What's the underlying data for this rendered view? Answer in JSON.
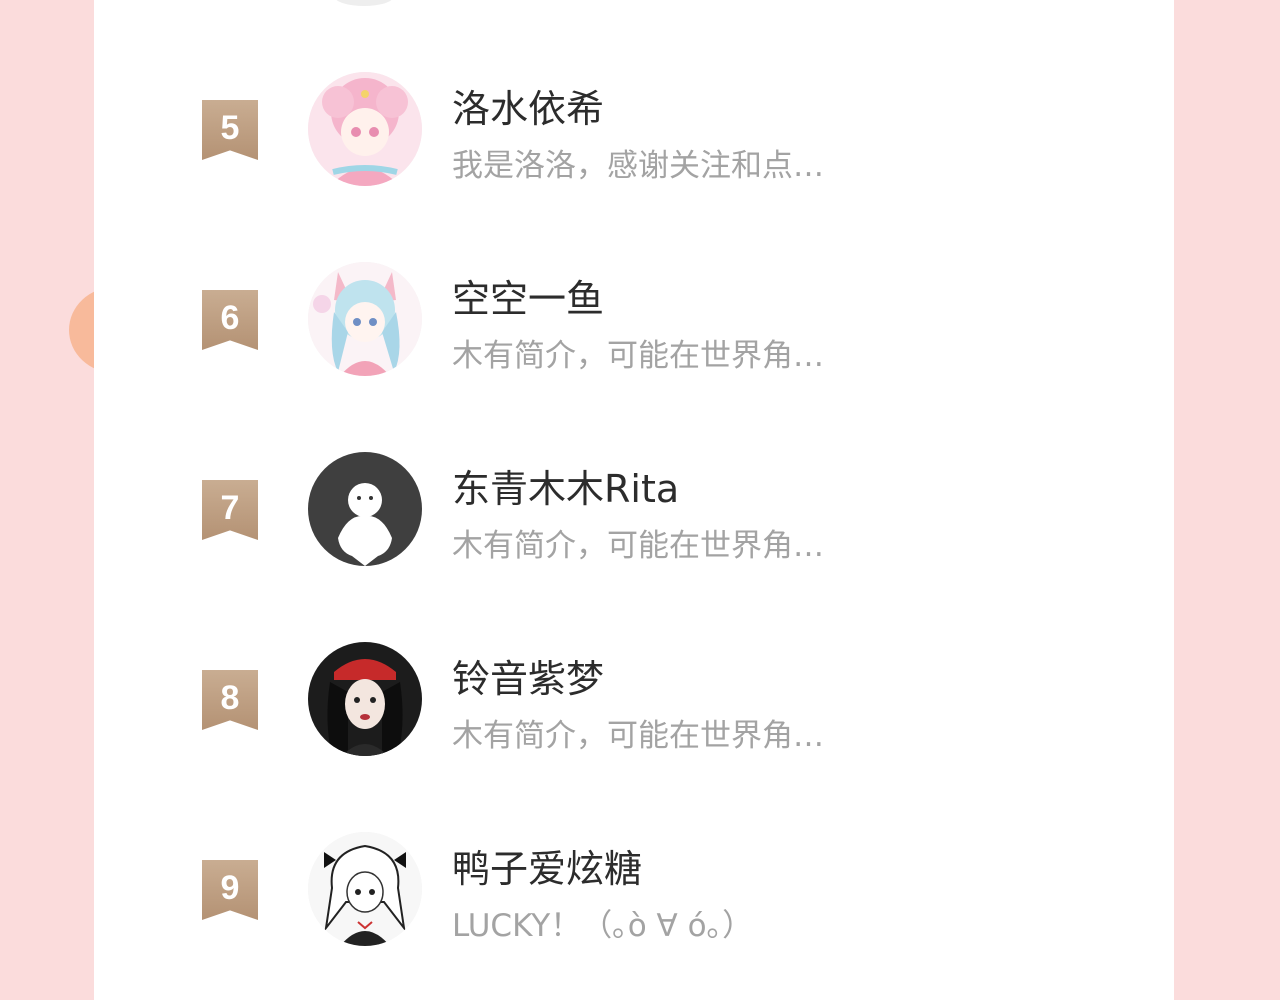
{
  "ranking": {
    "items": [
      {
        "rank": "5",
        "name": "洛水依希",
        "bio": "我是洛洛，感谢关注和点…",
        "avatar": "anime-pink-hair-avatar"
      },
      {
        "rank": "6",
        "name": "空空一鱼",
        "bio": "木有简介，可能在世界角…",
        "avatar": "anime-blue-hair-avatar"
      },
      {
        "rank": "7",
        "name": "东青木木Rita",
        "bio": "木有简介，可能在世界角…",
        "avatar": "default-ghost-avatar"
      },
      {
        "rank": "8",
        "name": "铃音紫梦",
        "bio": "木有简介，可能在世界角…",
        "avatar": "photo-red-cap-avatar"
      },
      {
        "rank": "9",
        "name": "鸭子爱炫糖",
        "bio": "LUCKY！（｡ò ∀ ó｡）",
        "avatar": "sketch-anime-avatar"
      }
    ]
  },
  "colors": {
    "background": "#fbdcdc",
    "card": "#ffffff",
    "rank_badge": "#bfa286",
    "name_text": "#2c2c2c",
    "bio_text": "#a3a3a3"
  }
}
